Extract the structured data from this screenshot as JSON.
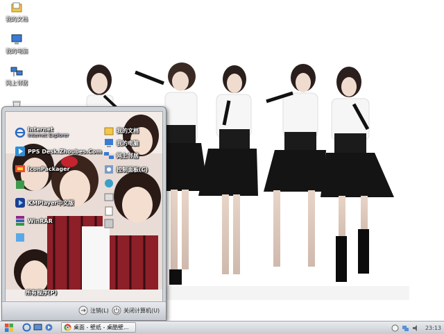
{
  "desktop": {
    "icons": [
      {
        "label": "我的文档",
        "icon": "my-documents-icon"
      },
      {
        "label": "我的电脑",
        "icon": "my-computer-icon"
      },
      {
        "label": "网上邻居",
        "icon": "network-places-icon"
      },
      {
        "label": "",
        "icon": "recycle-bin-icon"
      }
    ]
  },
  "start_menu": {
    "left_items": [
      {
        "label": "Internet",
        "sub": "Internet Explorer",
        "icon": "internet-explorer-icon"
      },
      {
        "label": "PPS Desk.Zhoubes.Com",
        "icon": "pps-icon"
      },
      {
        "label": "IconPackager",
        "icon": "iconpackager-icon"
      },
      {
        "label": "",
        "icon": "app-icon"
      },
      {
        "label": "KMPlayer中文版",
        "icon": "kmplayer-icon"
      },
      {
        "label": "WinRAR",
        "icon": "winrar-icon"
      },
      {
        "label": "",
        "icon": "app-icon"
      }
    ],
    "all_programs": "所有程序(P)",
    "right_items": [
      {
        "label": "我的文档",
        "icon": "my-documents-icon"
      },
      {
        "label": "我的电脑",
        "icon": "my-computer-icon"
      },
      {
        "label": "网上邻居",
        "icon": "network-places-icon"
      },
      {
        "label": "控制面板(C)",
        "icon": "control-panel-icon"
      },
      {
        "label": "",
        "icon": "app-icon"
      },
      {
        "label": "",
        "icon": "app-icon"
      },
      {
        "label": "",
        "icon": "app-icon"
      },
      {
        "label": "",
        "icon": "app-icon"
      }
    ],
    "logoff_label": "注销(L)",
    "shutdown_label": "关闭计算机(U)"
  },
  "taskbar": {
    "task_label": "桌面 - 壁纸 - 桌酷壁...",
    "clock": "23:13",
    "colors": {
      "bar": "#dfe2e6",
      "accent": "#2c6cc4"
    }
  }
}
